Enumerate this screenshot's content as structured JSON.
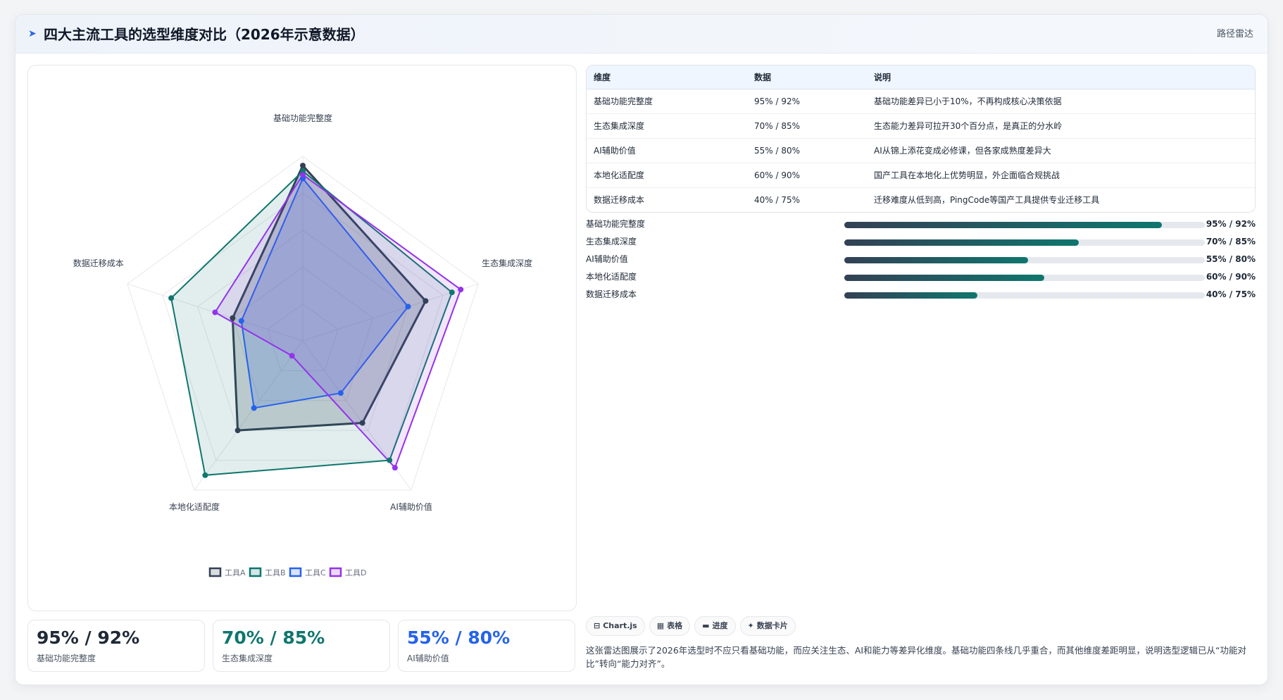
{
  "header": {
    "title": "四大主流工具的选型维度对比（2026年示意数据）",
    "link": "路径雷达"
  },
  "chart_data": {
    "type": "radar",
    "axes": [
      "基础功能完整度",
      "生态集成深度",
      "AI辅助价值",
      "本地化适配度",
      "数据迁移成本"
    ],
    "range": [
      0,
      100
    ],
    "grid": true,
    "legend_position": "bottom",
    "series": [
      {
        "name": "工具A",
        "color": "#334155",
        "values": [
          95,
          70,
          55,
          60,
          40
        ]
      },
      {
        "name": "工具B",
        "color": "#0f766e",
        "values": [
          92,
          85,
          80,
          90,
          75
        ]
      },
      {
        "name": "工具C",
        "color": "#2563eb",
        "values": [
          88,
          60,
          35,
          45,
          35
        ]
      },
      {
        "name": "工具D",
        "color": "#9333ea",
        "values": [
          90,
          90,
          85,
          10,
          50
        ]
      }
    ]
  },
  "kpis": [
    {
      "value": "95% / 92%",
      "label": "基础功能完整度",
      "color": "#1f2937"
    },
    {
      "value": "70% / 85%",
      "label": "生态集成深度",
      "color": "#0f766e"
    },
    {
      "value": "55% / 80%",
      "label": "AI辅助价值",
      "color": "#2563eb"
    }
  ],
  "table": {
    "headers": [
      "维度",
      "数据",
      "说明"
    ],
    "rows": [
      [
        "基础功能完整度",
        "95% / 92%",
        "基础功能差异已小于10%，不再构成核心决策依据"
      ],
      [
        "生态集成深度",
        "70% / 85%",
        "生态能力差异可拉开30个百分点，是真正的分水岭"
      ],
      [
        "AI辅助价值",
        "55% / 80%",
        "AI从锦上添花变成必修课，但各家成熟度差异大"
      ],
      [
        "本地化适配度",
        "60% / 90%",
        "国产工具在本地化上优势明显，外企面临合规挑战"
      ],
      [
        "数据迁移成本",
        "40% / 75%",
        "迁移难度从低到高，PingCode等国产工具提供专业迁移工具"
      ]
    ]
  },
  "progress": [
    {
      "label": "基础功能完整度",
      "value": "95% / 92%",
      "fill": 0.88
    },
    {
      "label": "生态集成深度",
      "value": "70% / 85%",
      "fill": 0.65
    },
    {
      "label": "AI辅助价值",
      "value": "55% / 80%",
      "fill": 0.51
    },
    {
      "label": "本地化适配度",
      "value": "60% / 90%",
      "fill": 0.555
    },
    {
      "label": "数据迁移成本",
      "value": "40% / 75%",
      "fill": 0.37
    }
  ],
  "chips": [
    {
      "icon": "⊟",
      "label": "Chart.js"
    },
    {
      "icon": "▦",
      "label": "表格"
    },
    {
      "icon": "▬",
      "label": "进度"
    },
    {
      "icon": "✦",
      "label": "数据卡片"
    }
  ],
  "description": "这张雷达图展示了2026年选型时不应只看基础功能，而应关注生态、AI和能力等差异化维度。基础功能四条线几乎重合，而其他维度差距明显，说明选型逻辑已从“功能对比”转向“能力对齐”。"
}
